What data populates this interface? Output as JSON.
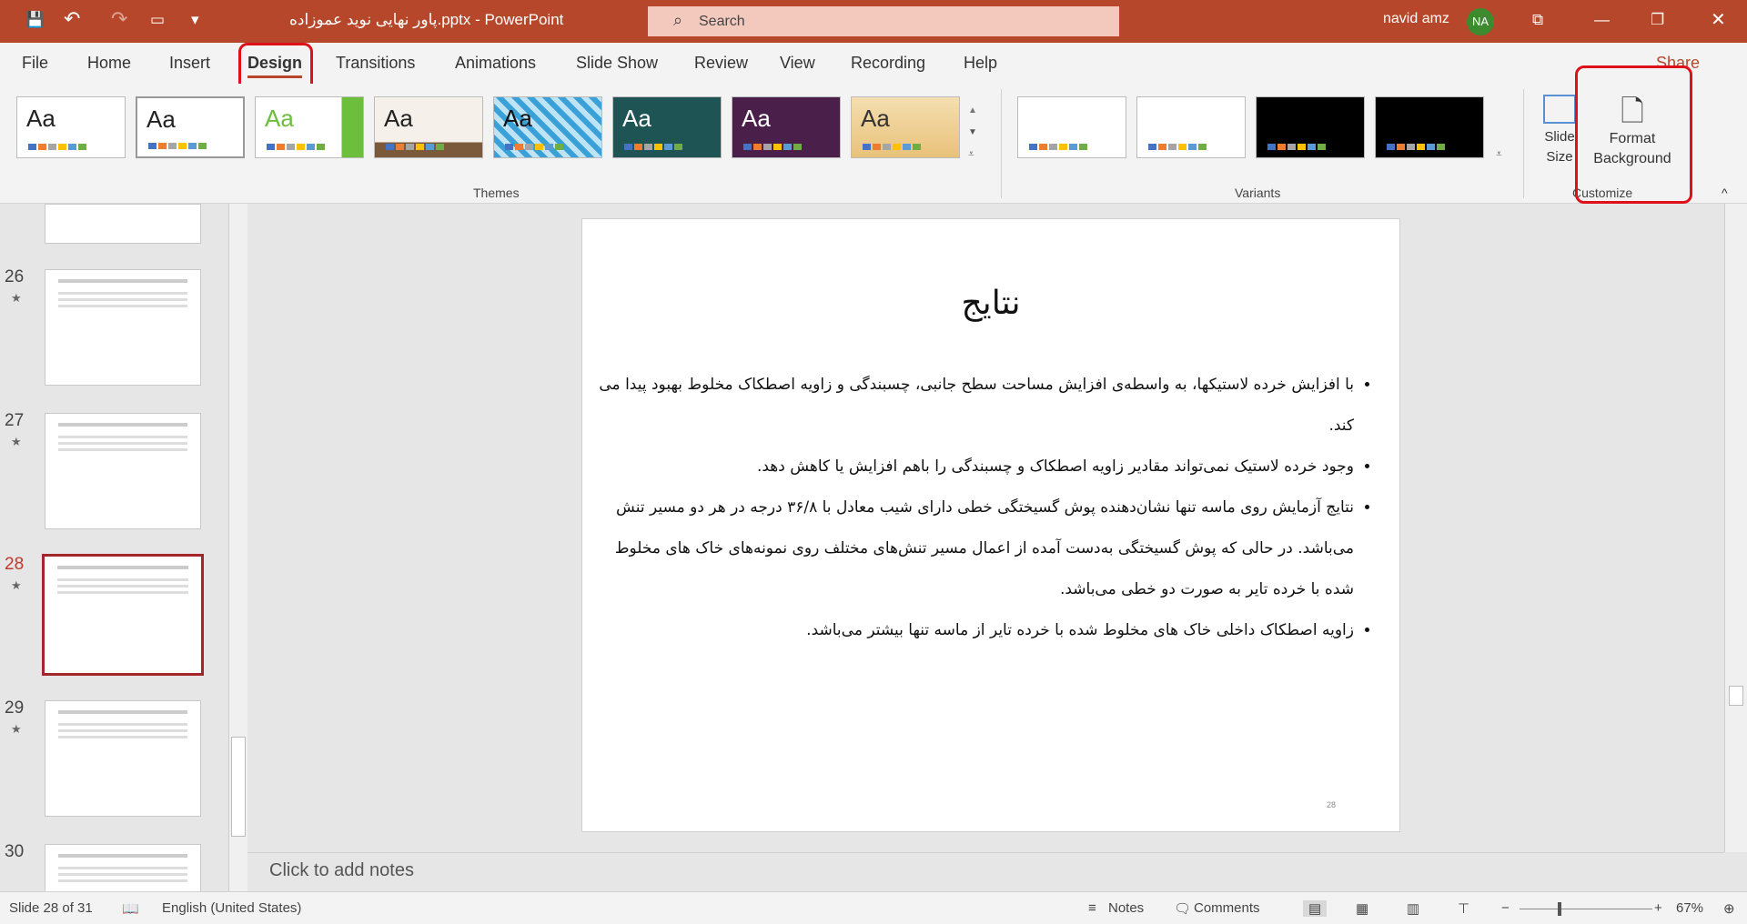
{
  "titlebar": {
    "title": "پاور نهایی نوید عموزاده.pptx  -  PowerPoint",
    "search_placeholder": "Search",
    "user": "navid amz",
    "initials": "NA"
  },
  "tabs": [
    "File",
    "Home",
    "Insert",
    "Design",
    "Transitions",
    "Animations",
    "Slide Show",
    "Review",
    "View",
    "Recording",
    "Help"
  ],
  "active_tab": "Design",
  "share": "Share",
  "ribbon": {
    "themes_label": "Themes",
    "variants_label": "Variants",
    "customize_label": "Customize",
    "slide_size": "Slide Size",
    "format_background": "Format Background",
    "theme_text": "Aa"
  },
  "thumbnails": [
    {
      "num": "26"
    },
    {
      "num": "27"
    },
    {
      "num": "28"
    },
    {
      "num": "29"
    },
    {
      "num": "30"
    }
  ],
  "slide": {
    "title": "نتایج",
    "bullets": [
      "با افزایش خرده لاستیکها، به واسطه‌ی افزایش مساحت سطح جانبی، چسبندگی و زاویه اصطکاک مخلوط بهبود پیدا می کند.",
      "وجود خرده لاستیک نمی‌تواند مقادیر زاویه اصطکاک و چسبندگی را باهم افزایش یا کاهش دهد.",
      "نتایج آزمایش روی ماسه تنها نشان‌دهنده پوش گسیختگی خطی دارای شیب معادل با ۳۶/۸ درجه در هر دو مسیر تنش می‌باشد. در حالی که پوش گسیختگی به‌دست آمده از اعمال مسیر تنش‌های مختلف روی نمونه‌های خاک های مخلوط شده با خرده تایر به صورت دو خطی می‌باشد.",
      "زاویه اصطکاک داخلی خاک های مخلوط شده با خرده تایر از ماسه تنها بیشتر می‌باشد."
    ],
    "number": "28"
  },
  "notes_placeholder": "Click to add notes",
  "status": {
    "slide": "Slide 28 of 31",
    "language": "English (United States)",
    "notes": "Notes",
    "comments": "Comments",
    "zoom": "67%"
  },
  "colors": {
    "accent": "#b7472a",
    "highlight": "#e0101a"
  }
}
